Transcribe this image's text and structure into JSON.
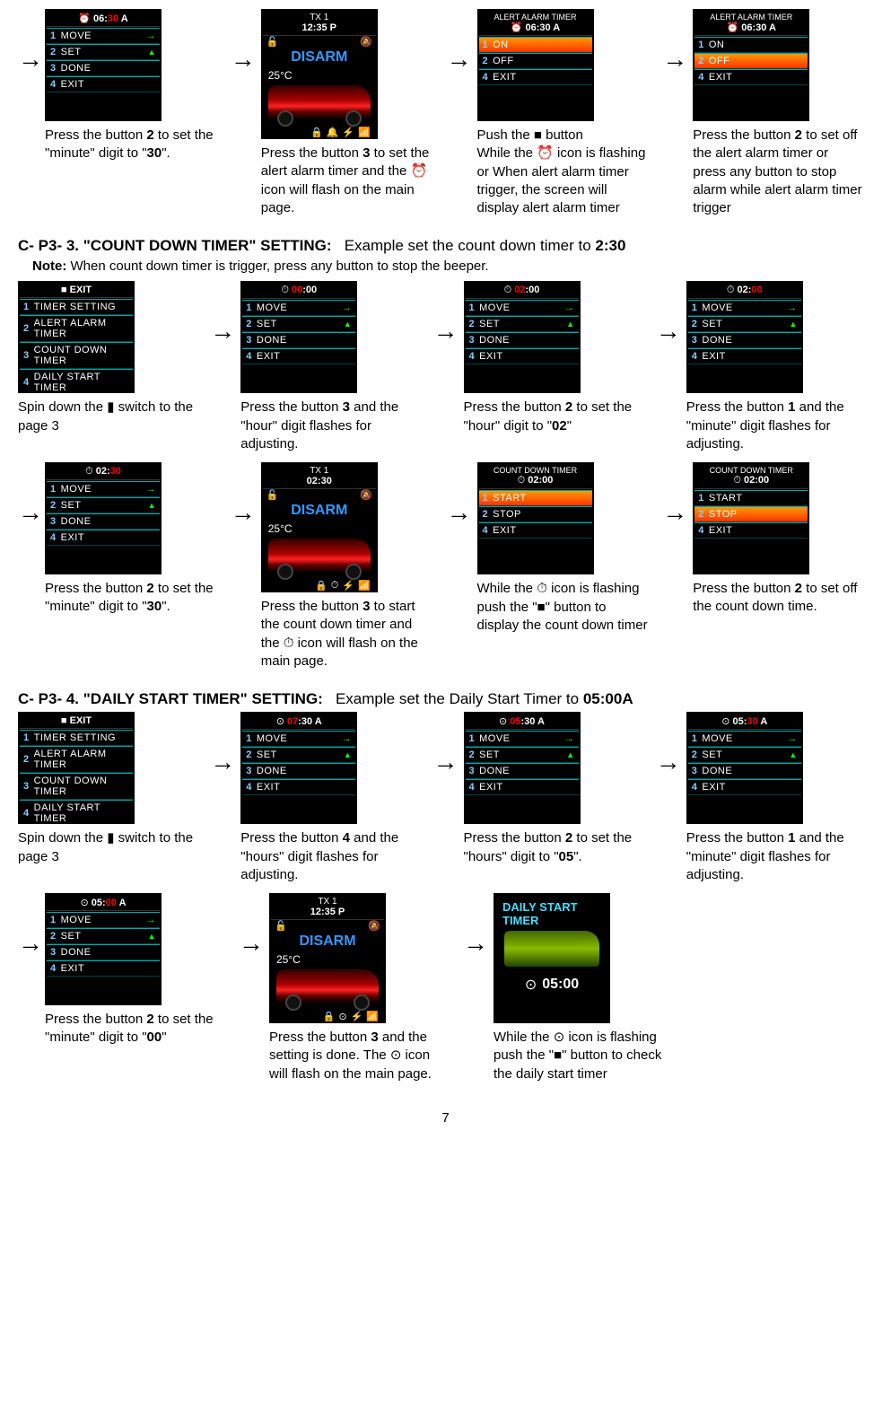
{
  "sectionA": {
    "steps": [
      {
        "screen": {
          "type": "menu",
          "header_icon": "alert",
          "header_time": "06:",
          "header_time_red": "30",
          "header_suffix": " A",
          "items": [
            {
              "n": "1",
              "t": "MOVE",
              "arrow": "→"
            },
            {
              "n": "2",
              "t": "SET",
              "tri": "▲"
            },
            {
              "n": "3",
              "t": "DONE"
            },
            {
              "n": "4",
              "t": "EXIT"
            }
          ]
        },
        "caption_html": "Press the button <b>2</b> to set the \"minute\" digit to \"<b>30</b>\"."
      },
      {
        "screen": {
          "type": "main",
          "tx": "TX 1",
          "time": "12:35 P",
          "status": "DISARM",
          "temp": "25°C",
          "iconbar": [
            "🔒",
            "🔔",
            "⚡",
            "📶"
          ]
        },
        "caption_html": "Press the button <b>3</b> to set the alert alarm timer and the <span class='inline-icon'>⏰</span> icon will flash on the main page."
      },
      {
        "screen": {
          "type": "alert",
          "header_title": "ALERT ALARM TIMER",
          "header_sub_icon": "⏰",
          "header_sub": "06:30 A",
          "items": [
            {
              "n": "1",
              "t": "ON",
              "hl": true
            },
            {
              "n": "2",
              "t": "OFF"
            },
            {
              "n": "4",
              "t": "EXIT"
            }
          ]
        },
        "caption_html": "Push the <span class='inline-icon'>■</span> button<br>While the <span class='inline-icon'>⏰</span> icon is flashing or When alert alarm timer trigger, the screen will display alert alarm timer"
      },
      {
        "screen": {
          "type": "alert",
          "header_title": "ALERT ALARM TIMER",
          "header_sub_icon": "⏰",
          "header_sub": "06:30 A",
          "items": [
            {
              "n": "1",
              "t": "ON"
            },
            {
              "n": "2",
              "t": "OFF",
              "hl": true
            },
            {
              "n": "4",
              "t": "EXIT"
            }
          ]
        },
        "caption_html": "Press the button <b>2</b> to set off the alert alarm timer or press any button to stop alarm while alert alarm timer trigger"
      }
    ]
  },
  "sectionB": {
    "heading_bold": "C- P3- 3. \"COUNT DOWN TIMER\" SETTING:",
    "heading_rest": "Example set the count down timer to",
    "heading_time": "2:30",
    "note_bold": "Note:",
    "note_rest": "When count down timer is trigger, press any button to stop the beeper.",
    "row1": [
      {
        "screen": {
          "type": "menu",
          "header_plain": "■ EXIT",
          "items": [
            {
              "n": "1",
              "t": "TIMER SETTING"
            },
            {
              "n": "2",
              "t": "ALERT ALARM TIMER"
            },
            {
              "n": "3",
              "t": "COUNT DOWN TIMER"
            },
            {
              "n": "4",
              "t": "DAILY START TIMER"
            }
          ]
        },
        "caption_html": "Spin down the <span class='inline-icon'>▮</span> switch to the page 3"
      },
      {
        "screen": {
          "type": "menu",
          "header_icon": "⏱",
          "header_time_red": "00",
          "header_time": ":00",
          "items": [
            {
              "n": "1",
              "t": "MOVE",
              "arrow": "→"
            },
            {
              "n": "2",
              "t": "SET",
              "tri": "▲"
            },
            {
              "n": "3",
              "t": "DONE"
            },
            {
              "n": "4",
              "t": "EXIT"
            }
          ]
        },
        "caption_html": "Press the button <b>3</b> and the \"hour\" digit flashes for adjusting."
      },
      {
        "screen": {
          "type": "menu",
          "header_icon": "⏱",
          "header_time_red": "02",
          "header_time": ":00",
          "items": [
            {
              "n": "1",
              "t": "MOVE",
              "arrow": "→"
            },
            {
              "n": "2",
              "t": "SET",
              "tri": "▲"
            },
            {
              "n": "3",
              "t": "DONE"
            },
            {
              "n": "4",
              "t": "EXIT"
            }
          ]
        },
        "caption_html": "Press the button <b>2</b> to set the \"hour\" digit to \"<b>02</b>\""
      },
      {
        "screen": {
          "type": "menu",
          "header_icon": "⏱",
          "header_time": "02:",
          "header_time_red": "00",
          "items": [
            {
              "n": "1",
              "t": "MOVE",
              "arrow": "→"
            },
            {
              "n": "2",
              "t": "SET",
              "tri": "▲"
            },
            {
              "n": "3",
              "t": "DONE"
            },
            {
              "n": "4",
              "t": "EXIT"
            }
          ]
        },
        "caption_html": "Press the button <b>1</b> and the \"minute\" digit flashes for adjusting."
      }
    ],
    "row2": [
      {
        "screen": {
          "type": "menu",
          "header_icon": "⏱",
          "header_time": "02:",
          "header_time_red": "30",
          "items": [
            {
              "n": "1",
              "t": "MOVE",
              "arrow": "→"
            },
            {
              "n": "2",
              "t": "SET",
              "tri": "▲"
            },
            {
              "n": "3",
              "t": "DONE"
            },
            {
              "n": "4",
              "t": "EXIT"
            }
          ]
        },
        "caption_html": "Press the button <b>2</b> to set the \"minute\" digit to \"<b>30</b>\"."
      },
      {
        "screen": {
          "type": "main",
          "tx": "TX 1",
          "time": "02:30",
          "status": "DISARM",
          "temp": "25°C",
          "iconbar": [
            "🔒",
            "⏱",
            "⚡",
            "📶"
          ]
        },
        "caption_html": "Press the button <b>3</b> to start the count down timer and the <span class='inline-icon'>⏱</span> icon will flash on the main page."
      },
      {
        "screen": {
          "type": "alert",
          "header_title": "COUNT DOWN TIMER",
          "header_sub_icon": "⏱",
          "header_sub": "02:00",
          "items": [
            {
              "n": "1",
              "t": "START",
              "hl": true
            },
            {
              "n": "2",
              "t": "STOP"
            },
            {
              "n": "4",
              "t": "EXIT"
            }
          ]
        },
        "caption_html": "While the <span class='inline-icon'>⏱</span> icon is flashing push the \"<span class='inline-icon'>■</span>\" button to display the count down timer"
      },
      {
        "screen": {
          "type": "alert",
          "header_title": "COUNT DOWN TIMER",
          "header_sub_icon": "⏱",
          "header_sub": "02:00",
          "items": [
            {
              "n": "1",
              "t": "START"
            },
            {
              "n": "2",
              "t": "STOP",
              "hl": true
            },
            {
              "n": "4",
              "t": "EXIT"
            }
          ]
        },
        "caption_html": "Press the button <b>2</b> to set off the count down time."
      }
    ]
  },
  "sectionC": {
    "heading_bold": "C- P3- 4. \"DAILY START TIMER\" SETTING:",
    "heading_rest": "Example set the Daily Start Timer to",
    "heading_time": "05:00A",
    "row1": [
      {
        "screen": {
          "type": "menu",
          "header_plain": "■ EXIT",
          "items": [
            {
              "n": "1",
              "t": "TIMER SETTING"
            },
            {
              "n": "2",
              "t": "ALERT ALARM TIMER"
            },
            {
              "n": "3",
              "t": "COUNT DOWN TIMER"
            },
            {
              "n": "4",
              "t": "DAILY START TIMER"
            }
          ]
        },
        "caption_html": "Spin down the <span class='inline-icon'>▮</span> switch to the page 3"
      },
      {
        "screen": {
          "type": "menu",
          "header_icon": "⊙",
          "header_time_red": "07",
          "header_time": ":30 A",
          "items": [
            {
              "n": "1",
              "t": "MOVE",
              "arrow": "→"
            },
            {
              "n": "2",
              "t": "SET",
              "tri": "▲"
            },
            {
              "n": "3",
              "t": "DONE"
            },
            {
              "n": "4",
              "t": "EXIT"
            }
          ]
        },
        "caption_html": "Press the button <b>4</b> and the \"hours\" digit flashes for adjusting."
      },
      {
        "screen": {
          "type": "menu",
          "header_icon": "⊙",
          "header_time_red": "05",
          "header_time": ":30 A",
          "items": [
            {
              "n": "1",
              "t": "MOVE",
              "arrow": "→"
            },
            {
              "n": "2",
              "t": "SET",
              "tri": "▲"
            },
            {
              "n": "3",
              "t": "DONE"
            },
            {
              "n": "4",
              "t": "EXIT"
            }
          ]
        },
        "caption_html": "Press the button <b>2</b> to set the \"hours\" digit to \"<b>05</b>\"."
      },
      {
        "screen": {
          "type": "menu",
          "header_icon": "⊙",
          "header_time": "05:",
          "header_time_red": "30",
          "header_suffix": " A",
          "items": [
            {
              "n": "1",
              "t": "MOVE",
              "arrow": "→"
            },
            {
              "n": "2",
              "t": "SET",
              "tri": "▲"
            },
            {
              "n": "3",
              "t": "DONE"
            },
            {
              "n": "4",
              "t": "EXIT"
            }
          ]
        },
        "caption_html": "Press the button <b>1</b> and the \"minute\" digit flashes for adjusting."
      }
    ],
    "row2": [
      {
        "screen": {
          "type": "menu",
          "header_icon": "⊙",
          "header_time": "05:",
          "header_time_red": "00",
          "header_suffix": " A",
          "items": [
            {
              "n": "1",
              "t": "MOVE",
              "arrow": "→"
            },
            {
              "n": "2",
              "t": "SET",
              "tri": "▲"
            },
            {
              "n": "3",
              "t": "DONE"
            },
            {
              "n": "4",
              "t": "EXIT"
            }
          ]
        },
        "caption_html": "Press the button <b>2</b> to set the \"minute\" digit to \"<b>00</b>\""
      },
      {
        "screen": {
          "type": "main",
          "tx": "TX 1",
          "time": "12:35 P",
          "status": "DISARM",
          "temp": "25°C",
          "iconbar": [
            "🔒",
            "⊙",
            "⚡",
            "📶"
          ]
        },
        "caption_html": "Press the button <b>3</b> and the setting is done. The <span class='inline-icon'>⊙</span> icon will flash on the main page."
      },
      {
        "screen": {
          "type": "daily",
          "header_title": "DAILY START TIMER",
          "time": "05:00"
        },
        "caption_html": "While the <span class='inline-icon'>⊙</span> icon is flashing push the \"<span class='inline-icon'>■</span>\" button to check the daily start timer"
      }
    ]
  },
  "page_number": "7"
}
